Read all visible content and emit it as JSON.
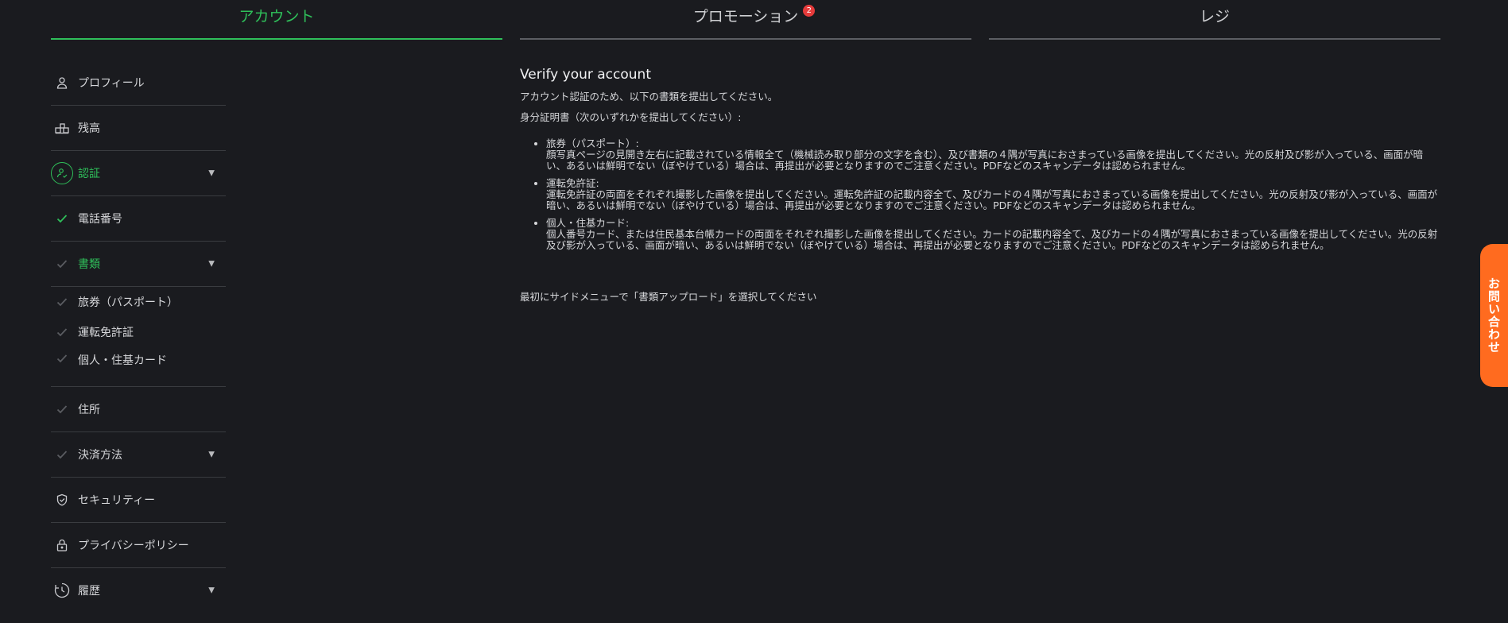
{
  "tabs": [
    {
      "label": "アカウント",
      "active": true
    },
    {
      "label": "プロモーション",
      "badge": "2"
    },
    {
      "label": "レジ"
    }
  ],
  "sidebar": {
    "items": [
      {
        "label": "プロフィール",
        "icon": "user-icon"
      },
      {
        "label": "残高",
        "icon": "coins-icon"
      },
      {
        "label": "認証",
        "icon": "verified-user-icon"
      },
      {
        "label": "電話番号",
        "icon": "check-icon"
      },
      {
        "label": "書類",
        "icon": "check-icon"
      },
      {
        "label": "旅券（パスポート）",
        "icon": "check-icon"
      },
      {
        "label": "運転免許証",
        "icon": "check-icon"
      },
      {
        "label": "個人・住基カード",
        "icon": "check-icon"
      },
      {
        "label": "住所",
        "icon": "check-icon"
      },
      {
        "label": "決済方法",
        "icon": "check-icon"
      },
      {
        "label": "セキュリティー",
        "icon": "shield-icon"
      },
      {
        "label": "プライバシーポリシー",
        "icon": "lock-icon"
      },
      {
        "label": "履歴",
        "icon": "clock-icon"
      }
    ]
  },
  "main": {
    "title": "Verify your account",
    "intro": "アカウント認証のため、以下の書類を提出してください。",
    "id_heading": "身分証明書（次のいずれかを提出してください）:",
    "documents": [
      {
        "title": "旅券（パスポート）:",
        "body": "顔写真ページの見開き左右に記載されている情報全て（機械読み取り部分の文字を含む）、及び書類の４隅が写真におさまっている画像を提出してください。光の反射及び影が入っている、画面が暗い、あるいは鮮明でない（ぼやけている）場合は、再提出が必要となりますのでご注意ください。PDFなどのスキャンデータは認められません。"
      },
      {
        "title": "運転免許証:",
        "body": "運転免許証の両面をそれぞれ撮影した画像を提出してください。運転免許証の記載内容全て、及びカードの４隅が写真におさまっている画像を提出してください。光の反射及び影が入っている、画面が暗い、あるいは鮮明でない（ぼやけている）場合は、再提出が必要となりますのでご注意ください。PDFなどのスキャンデータは認められません。"
      },
      {
        "title": "個人・住基カード:",
        "body": "個人番号カード、または住民基本台帳カードの両面をそれぞれ撮影した画像を提出してください。カードの記載内容全て、及びカードの４隅が写真におさまっている画像を提出してください。光の反射及び影が入っている、画面が暗い、あるいは鮮明でない（ぼやけている）場合は、再提出が必要となりますのでご注意ください。PDFなどのスキャンデータは認められません。"
      }
    ],
    "footer": "最初にサイドメニューで「書類アップロード」を選択してください"
  },
  "contact": {
    "label": "お問い合わせ"
  },
  "colors": {
    "accent": "#2fbf5a",
    "background": "#1a1b1f",
    "contact": "#ff6b1f",
    "badge": "#e53b3b"
  }
}
